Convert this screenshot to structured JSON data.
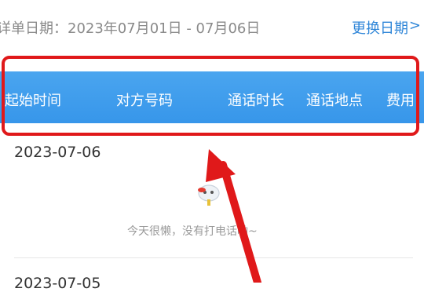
{
  "date_row": {
    "label": "详单日期：2023年07月01日 - 07月06日",
    "change_label": "更换日期",
    "chevron": ">"
  },
  "table_header": {
    "columns": [
      "起始时间",
      "对方号码",
      "通话时长",
      "通话地点",
      "费用"
    ]
  },
  "records": [
    {
      "date": "2023-07-06",
      "empty_text": "今天很懒，没有打电话哟~",
      "empty_icon": "lazy-cloud-icon"
    }
  ],
  "next_date": "2023-07-05",
  "colors": {
    "header_blue": "#3b9aeb",
    "highlight_red": "#e0191a",
    "link_blue": "#2f86d8"
  }
}
